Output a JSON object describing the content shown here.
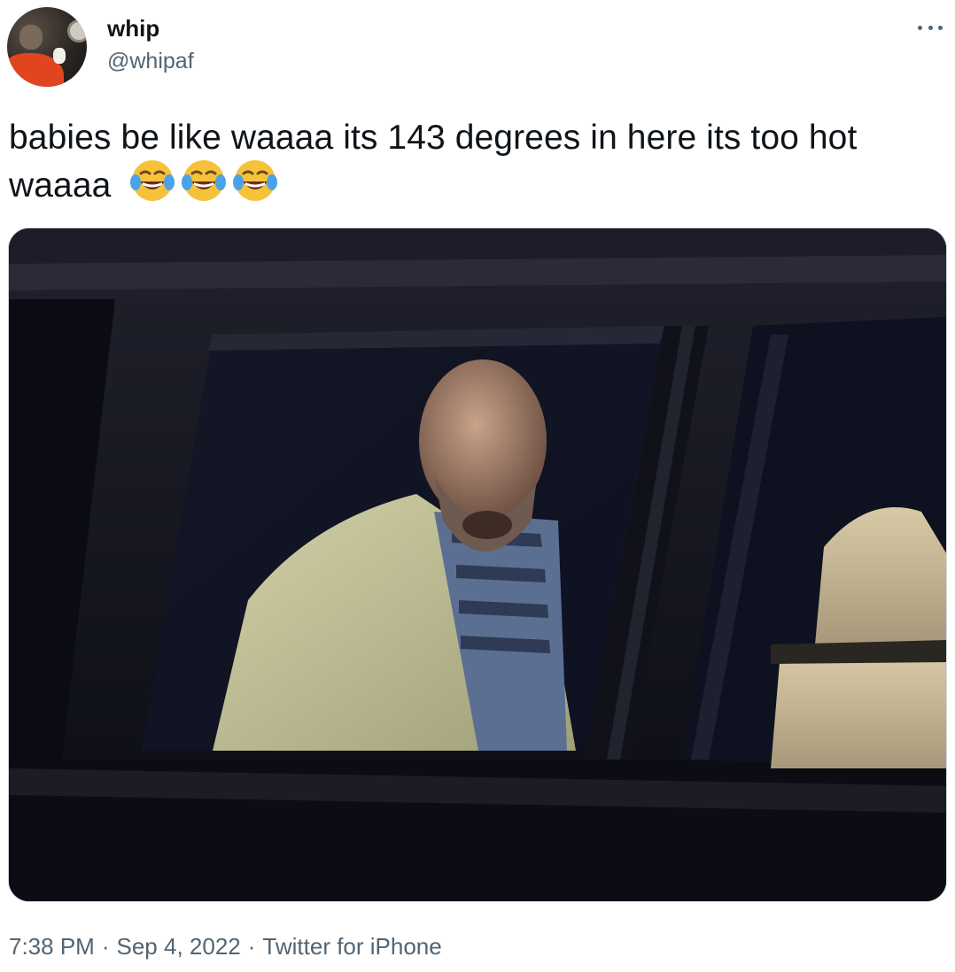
{
  "author": {
    "display_name": "whip",
    "handle": "@whipaf",
    "avatar_icon": "profile-photo"
  },
  "more_icon": "more-horizontal-icon",
  "tweet": {
    "text": "babies be like waaaa its 143 degrees in here its too hot waaaa",
    "emojis": [
      "face-with-tears-of-joy",
      "face-with-tears-of-joy",
      "face-with-tears-of-joy"
    ]
  },
  "media": {
    "type": "photo"
  },
  "meta": {
    "time": "7:38 PM",
    "date": "Sep 4, 2022",
    "source": "Twitter for iPhone",
    "separator": "·"
  },
  "colors": {
    "text_primary": "#0f1419",
    "text_secondary": "#536471",
    "border": "#cfd9de"
  }
}
